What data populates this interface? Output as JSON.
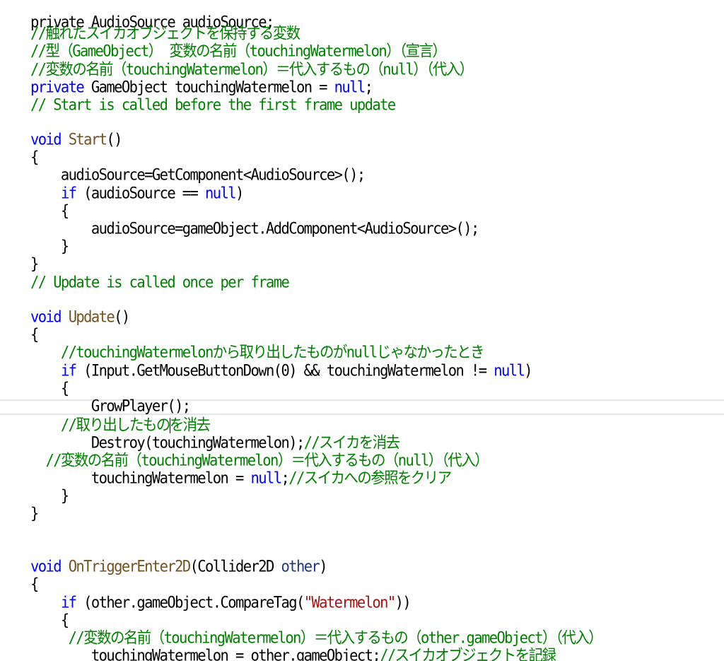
{
  "editor": {
    "lines": {
      "l0": {
        "t0": "private AudioSource audioSource;"
      },
      "l1": {
        "t0": "//触れたスイカオブジェクトを保持する変数"
      },
      "l2": {
        "t0": "//型（GameObject） 変数の名前（touchingWatermelon）（宣言）"
      },
      "l3": {
        "t0": "//変数の名前（touchingWatermelon）＝代入するもの（null）（代入）"
      },
      "l4": {
        "t0": "private",
        "t1": " GameObject touchingWatermelon = ",
        "t2": "null",
        "t3": ";"
      },
      "l5": {
        "t0": "// Start is called before the first frame update"
      },
      "l6": {
        "t0": "void",
        "t1": " ",
        "t2": "Start",
        "t3": "()"
      },
      "l7": {
        "t0": "{"
      },
      "l8": {
        "t0": "    audioSource=GetComponent<AudioSource>();"
      },
      "l9": {
        "t0": "    ",
        "t1": "if",
        "t2": " (audioSource == ",
        "t3": "null",
        "t4": ")"
      },
      "l10": {
        "t0": "    {"
      },
      "l11": {
        "t0": "        audioSource=gameObject.AddComponent<AudioSource>();"
      },
      "l12": {
        "t0": "    }"
      },
      "l13": {
        "t0": "}"
      },
      "l14": {
        "t0": "// Update is called once per frame"
      },
      "l15": {
        "t0": "void",
        "t1": " ",
        "t2": "Update",
        "t3": "()"
      },
      "l16": {
        "t0": "{"
      },
      "l17": {
        "t0": "    //touchingWatermelonから取り出したものがnullじゃなかったとき"
      },
      "l18": {
        "t0": "    ",
        "t1": "if",
        "t2": " (Input.GetMouseButtonDown(0) && touchingWatermelon != ",
        "t3": "null",
        "t4": ")"
      },
      "l19": {
        "t0": "    {"
      },
      "l20": {
        "t0": "        GrowPlayer();"
      },
      "l21": {
        "t0": "    //取り出したもの",
        "t1": "を消去"
      },
      "l22": {
        "t0": "        Destroy(touchingWatermelon);",
        "t1": "//スイカを消去"
      },
      "l23": {
        "t0": "  //変数の名前（touchingWatermelon）＝代入するもの（null）（代入）"
      },
      "l24": {
        "t0": "        touchingWatermelon = ",
        "t1": "null",
        "t2": ";",
        "t3": "//スイカへの参照をクリア"
      },
      "l25": {
        "t0": "    }"
      },
      "l26": {
        "t0": "}"
      },
      "l27": {
        "t0": "void",
        "t1": " ",
        "t2": "OnTriggerEnter2D",
        "t3": "(Collider2D ",
        "t4": "other",
        "t5": ")"
      },
      "l28": {
        "t0": "{"
      },
      "l29": {
        "t0": "    ",
        "t1": "if",
        "t2": " (other.gameObject.CompareTag(",
        "t3": "\"Watermelon\"",
        "t4": "))"
      },
      "l30": {
        "t0": "    {"
      },
      "l31": {
        "t0": "     //変数の名前（touchingWatermelon）＝代入するもの（other.gameObject）（代入）"
      },
      "l32": {
        "t0": "        touchingWatermelon = other.gameObject;",
        "t1": "//スイカオブジェクトを記録"
      },
      "l33": {
        "t0": "    }"
      }
    }
  },
  "colors": {
    "comment": "#008000",
    "keyword": "#0000ff",
    "type": "#2b91af",
    "method": "#74531f",
    "string": "#a31515",
    "parameter": "#1f377f",
    "current_line_border": "#e4e4ea"
  }
}
